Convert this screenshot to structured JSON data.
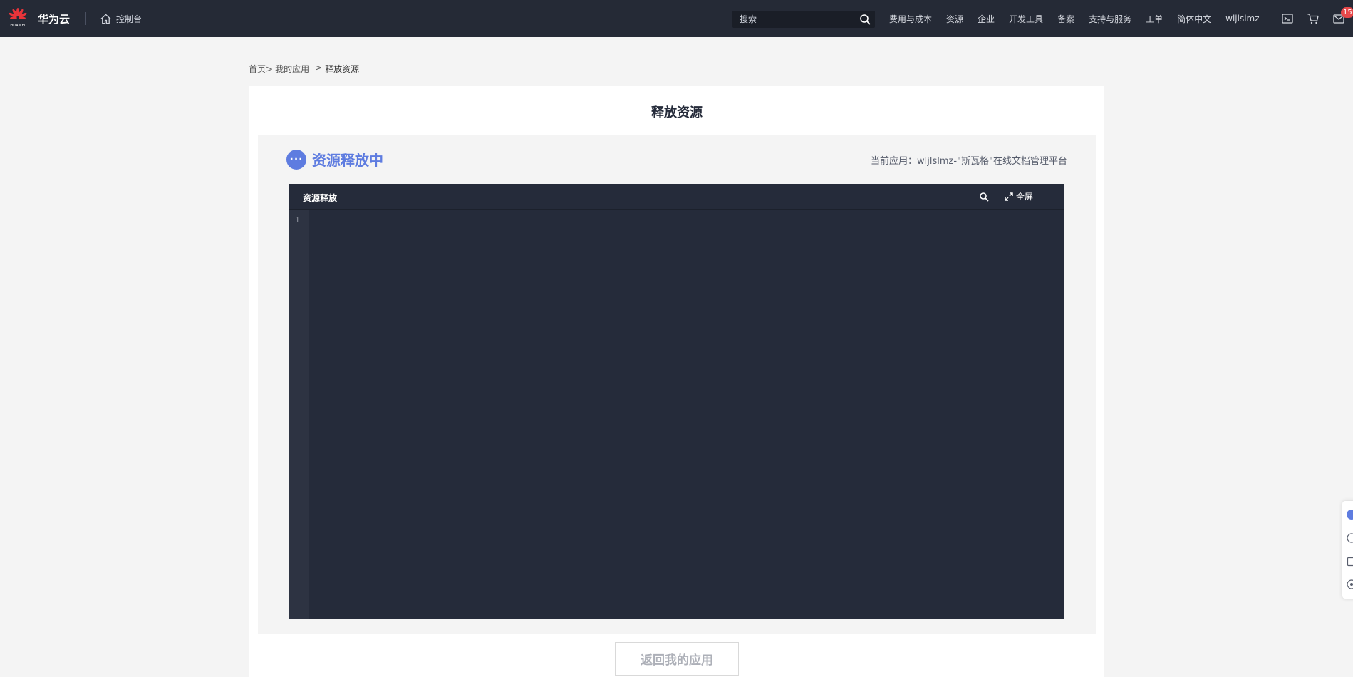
{
  "topbar": {
    "brand_logo_text": "HUAWEI",
    "brand_name": "华为云",
    "console_label": "控制台",
    "search_placeholder": "搜索",
    "nav_links": [
      "费用与成本",
      "资源",
      "企业",
      "开发工具",
      "备案",
      "支持与服务",
      "工单",
      "简体中文",
      "wljlslmz"
    ],
    "message_count": "15"
  },
  "breadcrumb": {
    "home": "首页>",
    "my_apps": "我的应用",
    "separator": ">",
    "current": "释放资源"
  },
  "page": {
    "title": "释放资源",
    "status_icon_glyph": "···",
    "status_text": "资源释放中",
    "current_app": "当前应用：wljlslmz-\"斯瓦格\"在线文档管理平台"
  },
  "console": {
    "title": "资源释放",
    "fullscreen_label": "全屏",
    "line_numbers": [
      "1"
    ]
  },
  "actions": {
    "back_label": "返回我的应用"
  },
  "colors": {
    "topbar_bg": "#252a36",
    "accent": "#5e7ce0",
    "console_bg": "#252b3a",
    "badge": "#e8484a"
  }
}
